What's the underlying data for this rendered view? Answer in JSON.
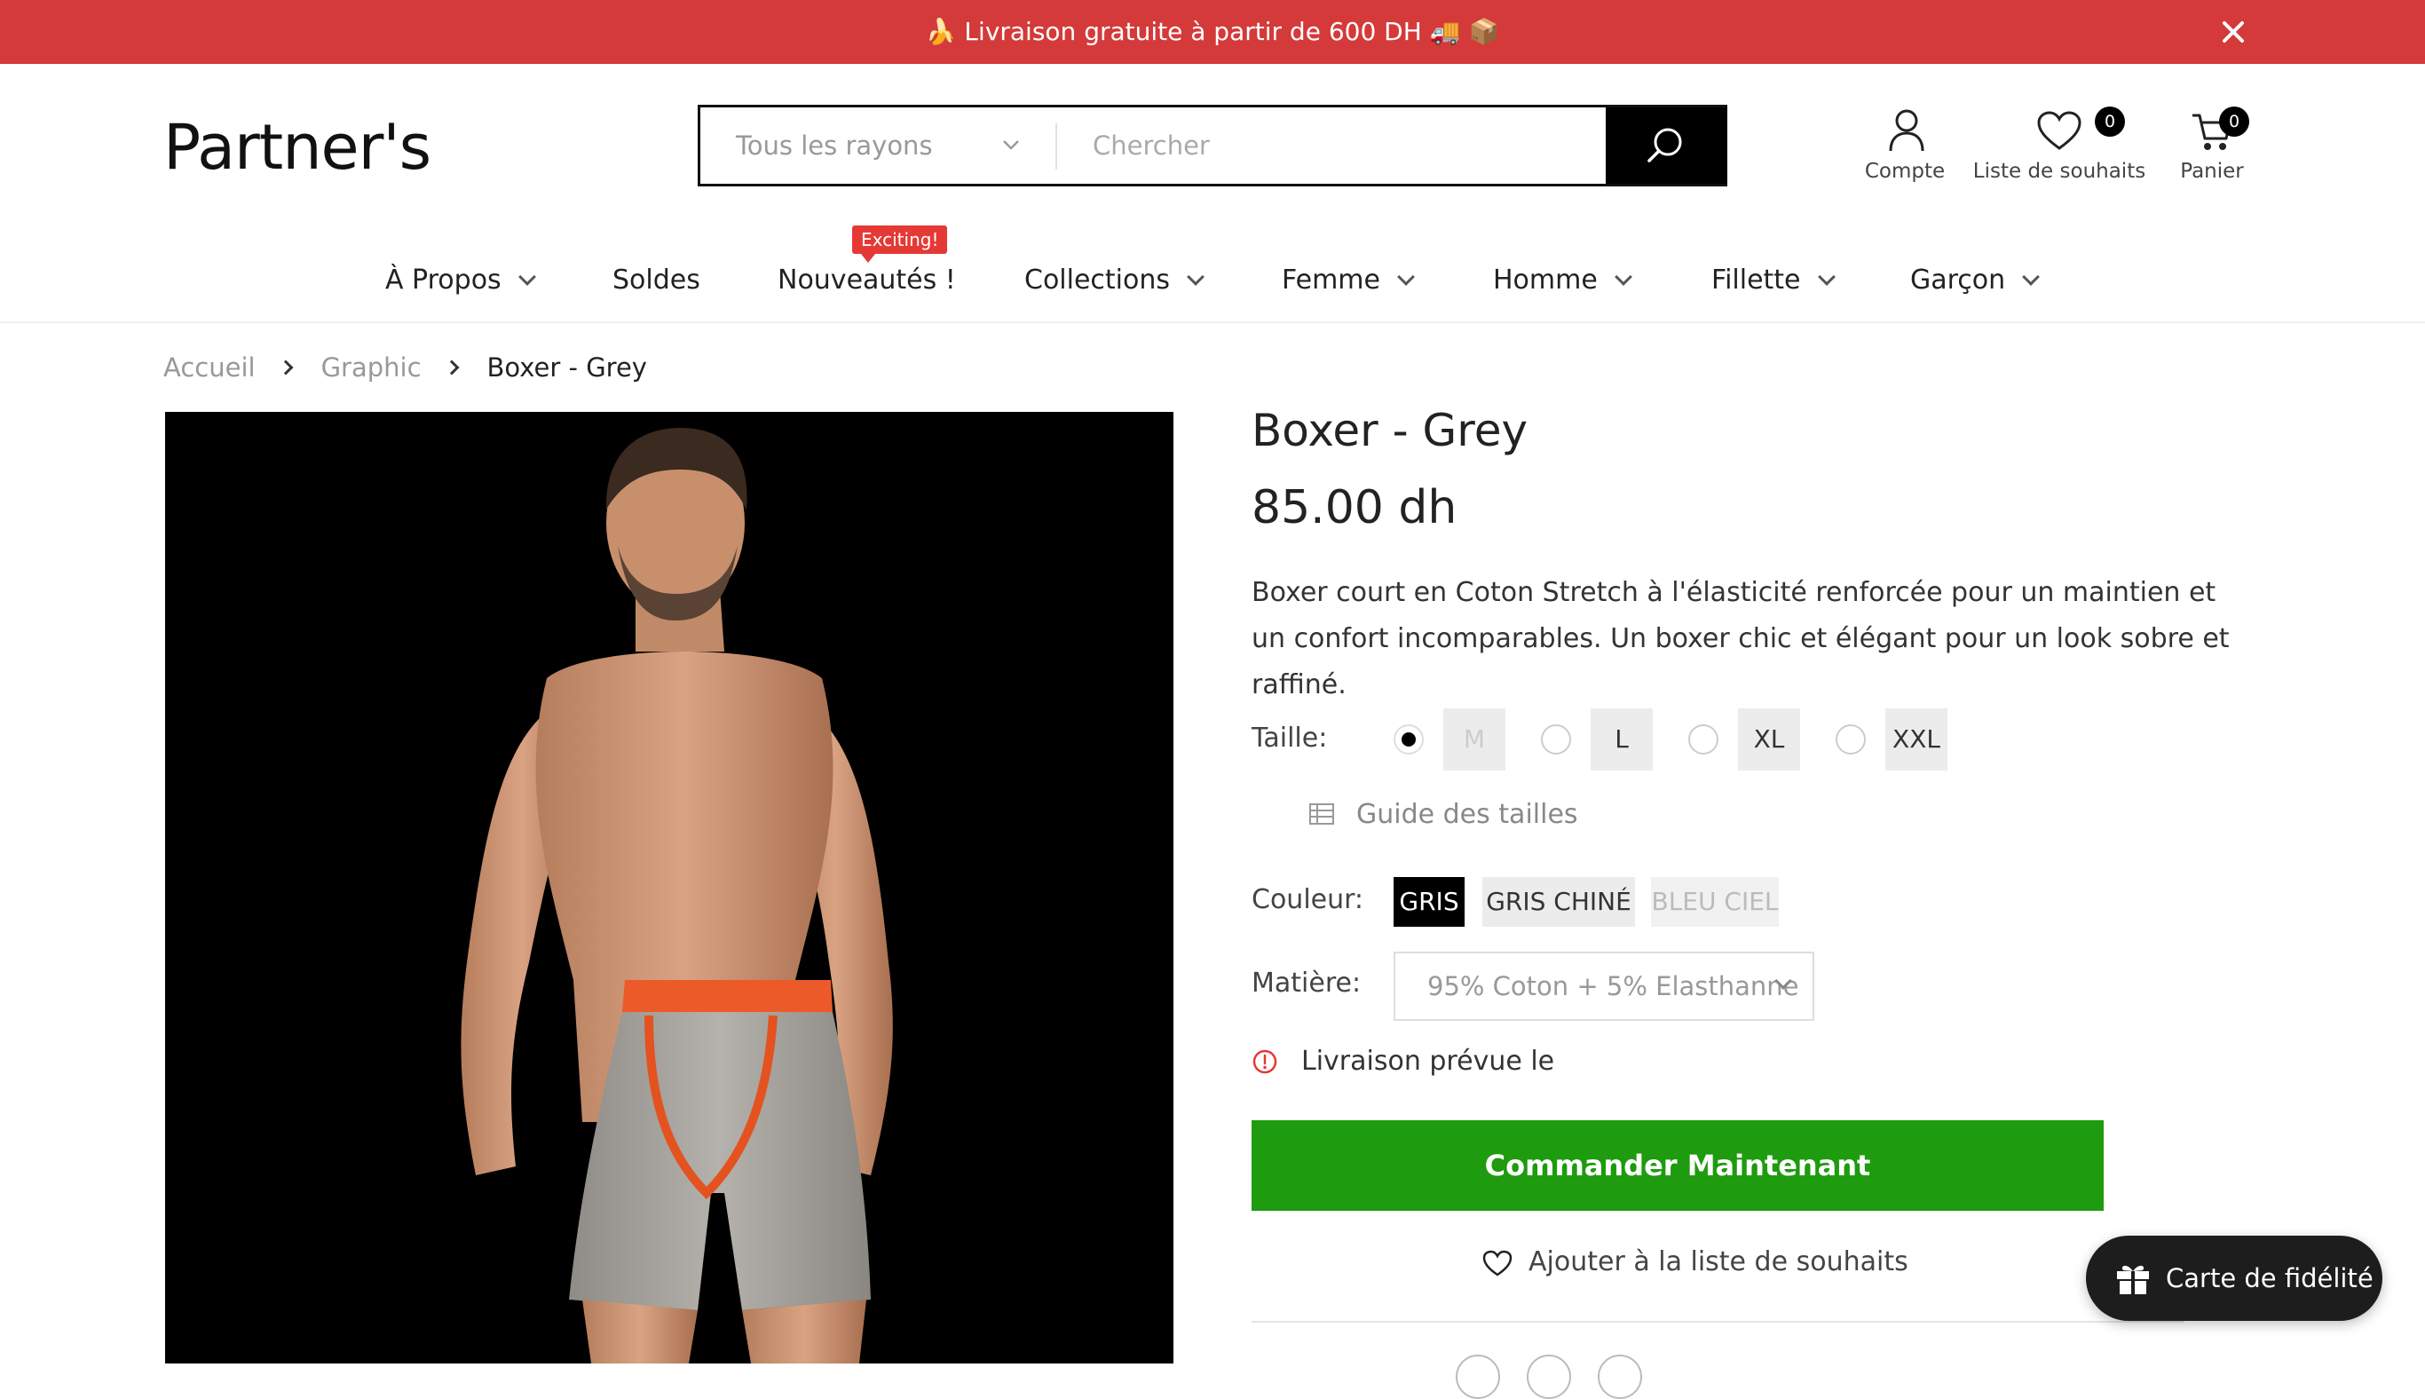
{
  "announcement": {
    "text": "🍌 Livraison gratuite à partir de 600 DH 🚚 📦",
    "bg_color": "#d43a3a"
  },
  "header": {
    "logo": "Partner's",
    "search": {
      "category": "Tous les rayons",
      "placeholder": "Chercher"
    },
    "account_label": "Compte",
    "wishlist_label": "Liste de souhaits",
    "wishlist_count": "0",
    "cart_label": "Panier",
    "cart_count": "0"
  },
  "nav": {
    "badge": "Exciting!",
    "items": [
      {
        "label": "À Propos",
        "has_dropdown": true
      },
      {
        "label": "Soldes",
        "has_dropdown": false
      },
      {
        "label": "Nouveautés !",
        "has_dropdown": false
      },
      {
        "label": "Collections",
        "has_dropdown": true
      },
      {
        "label": "Femme",
        "has_dropdown": true
      },
      {
        "label": "Homme",
        "has_dropdown": true
      },
      {
        "label": "Fillette",
        "has_dropdown": true
      },
      {
        "label": "Garçon",
        "has_dropdown": true
      }
    ]
  },
  "breadcrumb": [
    "Accueil",
    "Graphic",
    "Boxer - Grey"
  ],
  "product": {
    "title": "Boxer - Grey",
    "price": "85.00 dh",
    "description": "Boxer court en Coton Stretch à l'élasticité renforcée pour un maintien et un confort incomparables. Un boxer chic et élégant pour un look sobre et raffiné.",
    "image_alt": "Partner's",
    "size_label": "Taille:",
    "sizes": [
      {
        "label": "M",
        "selected": true,
        "available": false
      },
      {
        "label": "L",
        "selected": false,
        "available": true
      },
      {
        "label": "XL",
        "selected": false,
        "available": true
      },
      {
        "label": "XXL",
        "selected": false,
        "available": true
      }
    ],
    "size_guide": "Guide des tailles",
    "color_label": "Couleur:",
    "colors": [
      {
        "label": "GRIS",
        "selected": true,
        "available": true
      },
      {
        "label": "GRIS CHINÉ",
        "selected": false,
        "available": true
      },
      {
        "label": "BLEU CIEL",
        "selected": false,
        "available": false
      }
    ],
    "material_label": "Matière:",
    "material_value": "95% Coton + 5% Elasthanne",
    "delivery_text": "Livraison prévue le",
    "order_button": "Commander Maintenant",
    "wishlist_button": "Ajouter à la liste de souhaits",
    "order_button_color": "#1e9b0e"
  },
  "loyalty_button": "Carte de fidélité"
}
